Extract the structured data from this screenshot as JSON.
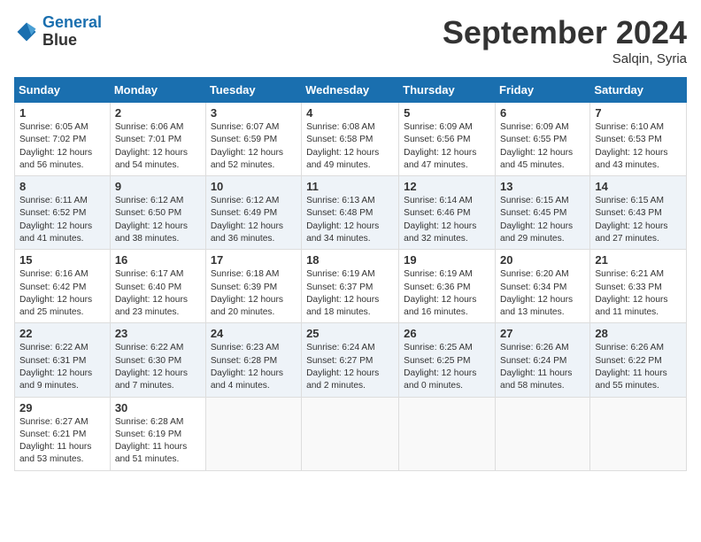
{
  "logo": {
    "line1": "General",
    "line2": "Blue"
  },
  "title": "September 2024",
  "subtitle": "Salqin, Syria",
  "headers": [
    "Sunday",
    "Monday",
    "Tuesday",
    "Wednesday",
    "Thursday",
    "Friday",
    "Saturday"
  ],
  "weeks": [
    [
      {
        "day": "1",
        "sunrise": "Sunrise: 6:05 AM",
        "sunset": "Sunset: 7:02 PM",
        "daylight": "Daylight: 12 hours and 56 minutes."
      },
      {
        "day": "2",
        "sunrise": "Sunrise: 6:06 AM",
        "sunset": "Sunset: 7:01 PM",
        "daylight": "Daylight: 12 hours and 54 minutes."
      },
      {
        "day": "3",
        "sunrise": "Sunrise: 6:07 AM",
        "sunset": "Sunset: 6:59 PM",
        "daylight": "Daylight: 12 hours and 52 minutes."
      },
      {
        "day": "4",
        "sunrise": "Sunrise: 6:08 AM",
        "sunset": "Sunset: 6:58 PM",
        "daylight": "Daylight: 12 hours and 49 minutes."
      },
      {
        "day": "5",
        "sunrise": "Sunrise: 6:09 AM",
        "sunset": "Sunset: 6:56 PM",
        "daylight": "Daylight: 12 hours and 47 minutes."
      },
      {
        "day": "6",
        "sunrise": "Sunrise: 6:09 AM",
        "sunset": "Sunset: 6:55 PM",
        "daylight": "Daylight: 12 hours and 45 minutes."
      },
      {
        "day": "7",
        "sunrise": "Sunrise: 6:10 AM",
        "sunset": "Sunset: 6:53 PM",
        "daylight": "Daylight: 12 hours and 43 minutes."
      }
    ],
    [
      {
        "day": "8",
        "sunrise": "Sunrise: 6:11 AM",
        "sunset": "Sunset: 6:52 PM",
        "daylight": "Daylight: 12 hours and 41 minutes."
      },
      {
        "day": "9",
        "sunrise": "Sunrise: 6:12 AM",
        "sunset": "Sunset: 6:50 PM",
        "daylight": "Daylight: 12 hours and 38 minutes."
      },
      {
        "day": "10",
        "sunrise": "Sunrise: 6:12 AM",
        "sunset": "Sunset: 6:49 PM",
        "daylight": "Daylight: 12 hours and 36 minutes."
      },
      {
        "day": "11",
        "sunrise": "Sunrise: 6:13 AM",
        "sunset": "Sunset: 6:48 PM",
        "daylight": "Daylight: 12 hours and 34 minutes."
      },
      {
        "day": "12",
        "sunrise": "Sunrise: 6:14 AM",
        "sunset": "Sunset: 6:46 PM",
        "daylight": "Daylight: 12 hours and 32 minutes."
      },
      {
        "day": "13",
        "sunrise": "Sunrise: 6:15 AM",
        "sunset": "Sunset: 6:45 PM",
        "daylight": "Daylight: 12 hours and 29 minutes."
      },
      {
        "day": "14",
        "sunrise": "Sunrise: 6:15 AM",
        "sunset": "Sunset: 6:43 PM",
        "daylight": "Daylight: 12 hours and 27 minutes."
      }
    ],
    [
      {
        "day": "15",
        "sunrise": "Sunrise: 6:16 AM",
        "sunset": "Sunset: 6:42 PM",
        "daylight": "Daylight: 12 hours and 25 minutes."
      },
      {
        "day": "16",
        "sunrise": "Sunrise: 6:17 AM",
        "sunset": "Sunset: 6:40 PM",
        "daylight": "Daylight: 12 hours and 23 minutes."
      },
      {
        "day": "17",
        "sunrise": "Sunrise: 6:18 AM",
        "sunset": "Sunset: 6:39 PM",
        "daylight": "Daylight: 12 hours and 20 minutes."
      },
      {
        "day": "18",
        "sunrise": "Sunrise: 6:19 AM",
        "sunset": "Sunset: 6:37 PM",
        "daylight": "Daylight: 12 hours and 18 minutes."
      },
      {
        "day": "19",
        "sunrise": "Sunrise: 6:19 AM",
        "sunset": "Sunset: 6:36 PM",
        "daylight": "Daylight: 12 hours and 16 minutes."
      },
      {
        "day": "20",
        "sunrise": "Sunrise: 6:20 AM",
        "sunset": "Sunset: 6:34 PM",
        "daylight": "Daylight: 12 hours and 13 minutes."
      },
      {
        "day": "21",
        "sunrise": "Sunrise: 6:21 AM",
        "sunset": "Sunset: 6:33 PM",
        "daylight": "Daylight: 12 hours and 11 minutes."
      }
    ],
    [
      {
        "day": "22",
        "sunrise": "Sunrise: 6:22 AM",
        "sunset": "Sunset: 6:31 PM",
        "daylight": "Daylight: 12 hours and 9 minutes."
      },
      {
        "day": "23",
        "sunrise": "Sunrise: 6:22 AM",
        "sunset": "Sunset: 6:30 PM",
        "daylight": "Daylight: 12 hours and 7 minutes."
      },
      {
        "day": "24",
        "sunrise": "Sunrise: 6:23 AM",
        "sunset": "Sunset: 6:28 PM",
        "daylight": "Daylight: 12 hours and 4 minutes."
      },
      {
        "day": "25",
        "sunrise": "Sunrise: 6:24 AM",
        "sunset": "Sunset: 6:27 PM",
        "daylight": "Daylight: 12 hours and 2 minutes."
      },
      {
        "day": "26",
        "sunrise": "Sunrise: 6:25 AM",
        "sunset": "Sunset: 6:25 PM",
        "daylight": "Daylight: 12 hours and 0 minutes."
      },
      {
        "day": "27",
        "sunrise": "Sunrise: 6:26 AM",
        "sunset": "Sunset: 6:24 PM",
        "daylight": "Daylight: 11 hours and 58 minutes."
      },
      {
        "day": "28",
        "sunrise": "Sunrise: 6:26 AM",
        "sunset": "Sunset: 6:22 PM",
        "daylight": "Daylight: 11 hours and 55 minutes."
      }
    ],
    [
      {
        "day": "29",
        "sunrise": "Sunrise: 6:27 AM",
        "sunset": "Sunset: 6:21 PM",
        "daylight": "Daylight: 11 hours and 53 minutes."
      },
      {
        "day": "30",
        "sunrise": "Sunrise: 6:28 AM",
        "sunset": "Sunset: 6:19 PM",
        "daylight": "Daylight: 11 hours and 51 minutes."
      },
      null,
      null,
      null,
      null,
      null
    ]
  ]
}
